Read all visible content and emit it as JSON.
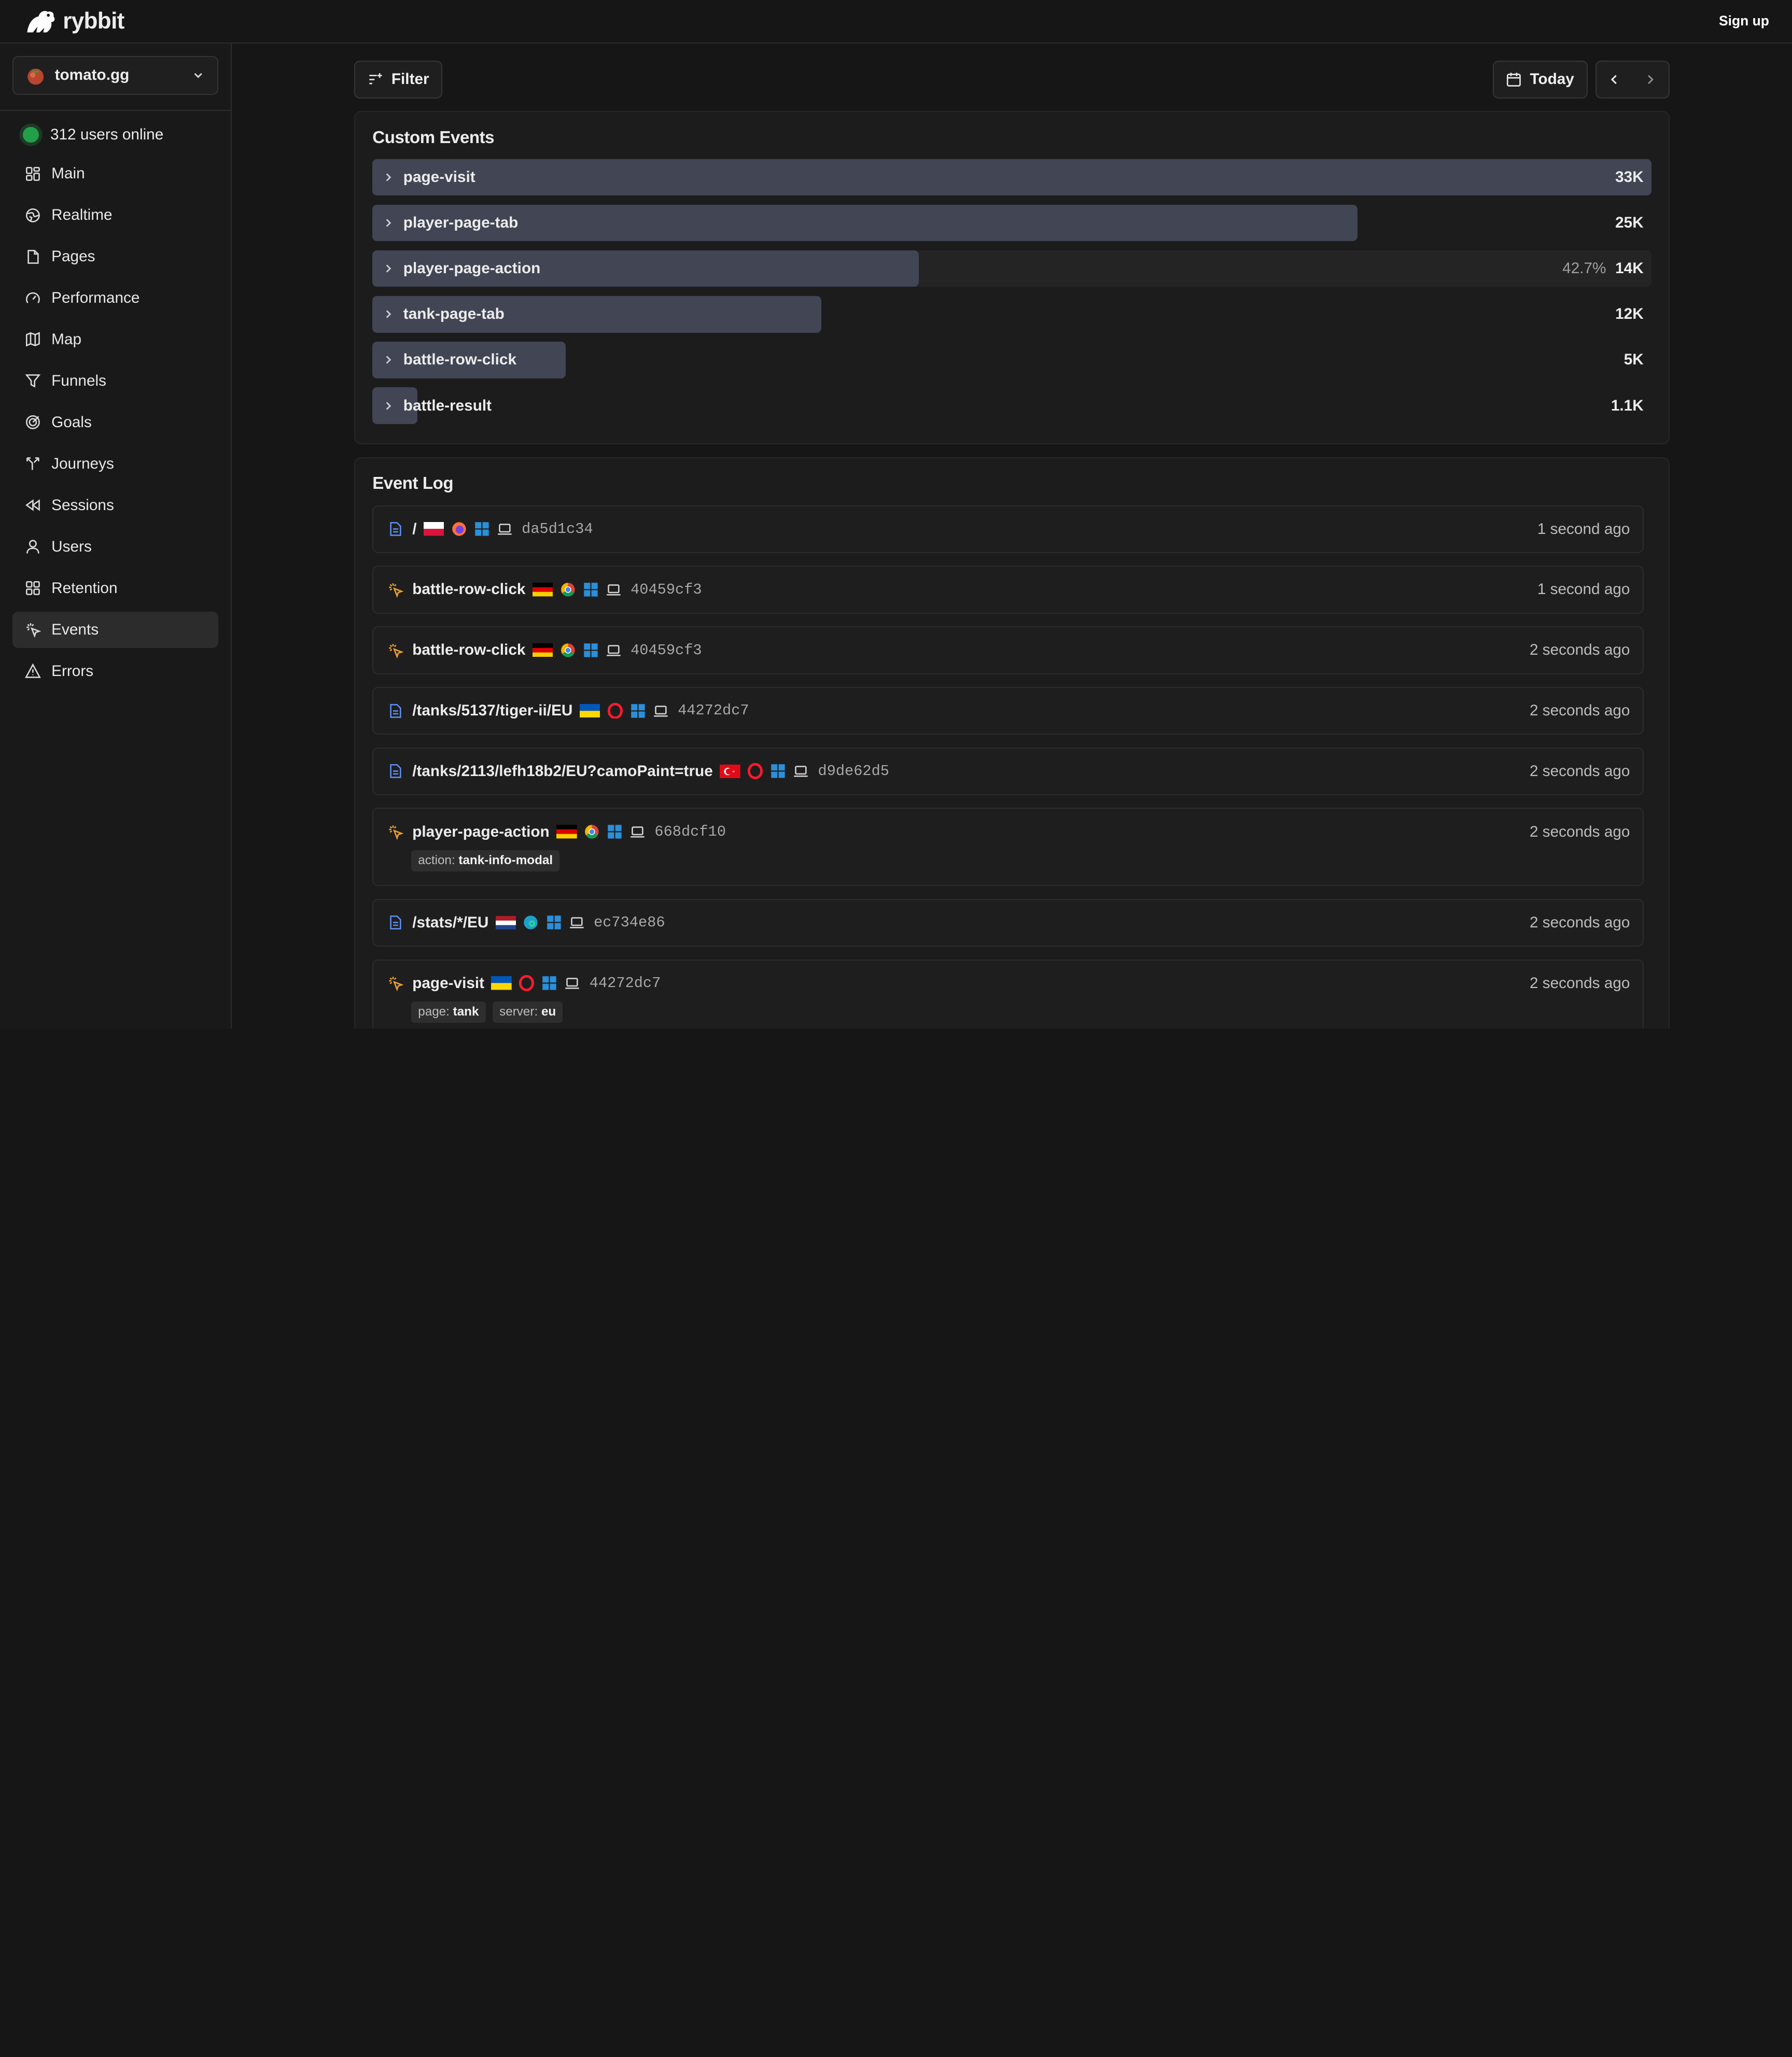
{
  "app": {
    "brand": "rybbit",
    "signup": "Sign up"
  },
  "sidebar": {
    "site": "tomato.gg",
    "online": "312 users online",
    "items": [
      {
        "label": "Main",
        "icon": "grid-icon"
      },
      {
        "label": "Realtime",
        "icon": "globe-icon"
      },
      {
        "label": "Pages",
        "icon": "file-icon"
      },
      {
        "label": "Performance",
        "icon": "gauge-icon"
      },
      {
        "label": "Map",
        "icon": "map-icon"
      },
      {
        "label": "Funnels",
        "icon": "funnel-icon"
      },
      {
        "label": "Goals",
        "icon": "target-icon"
      },
      {
        "label": "Journeys",
        "icon": "split-icon"
      },
      {
        "label": "Sessions",
        "icon": "rewind-icon"
      },
      {
        "label": "Users",
        "icon": "user-icon"
      },
      {
        "label": "Retention",
        "icon": "grid-icon"
      },
      {
        "label": "Events",
        "icon": "sparkle-icon",
        "active": true
      },
      {
        "label": "Errors",
        "icon": "warning-icon"
      }
    ]
  },
  "toolbar": {
    "filter": "Filter",
    "date": "Today"
  },
  "custom_events": {
    "title": "Custom Events",
    "rows": [
      {
        "name": "page-visit",
        "value": "33K",
        "fraction": 1.0
      },
      {
        "name": "player-page-tab",
        "value": "25K",
        "fraction": 0.77
      },
      {
        "name": "player-page-action",
        "value": "14K",
        "pct": "42.7%",
        "fraction": 0.427
      },
      {
        "name": "tank-page-tab",
        "value": "12K",
        "fraction": 0.351
      },
      {
        "name": "battle-row-click",
        "value": "5K",
        "fraction": 0.151
      },
      {
        "name": "battle-result",
        "value": "1.1K",
        "fraction": 0.035
      }
    ]
  },
  "event_log": {
    "title": "Event Log",
    "items": [
      {
        "type": "pageview",
        "name": "/",
        "flag": "pl",
        "browser": "firefox",
        "hash": "da5d1c34",
        "time": "1 second ago"
      },
      {
        "type": "event",
        "name": "battle-row-click",
        "flag": "de",
        "browser": "chrome",
        "hash": "40459cf3",
        "time": "1 second ago"
      },
      {
        "type": "event",
        "name": "battle-row-click",
        "flag": "de",
        "browser": "chrome",
        "hash": "40459cf3",
        "time": "2 seconds ago"
      },
      {
        "type": "pageview",
        "name": "/tanks/5137/tiger-ii/EU",
        "flag": "ua",
        "browser": "opera",
        "hash": "44272dc7",
        "time": "2 seconds ago"
      },
      {
        "type": "pageview",
        "name": "/tanks/2113/lefh18b2/EU?camoPaint=true",
        "flag": "tr",
        "browser": "opera",
        "hash": "d9de62d5",
        "time": "2 seconds ago"
      },
      {
        "type": "event",
        "name": "player-page-action",
        "flag": "de",
        "browser": "chrome",
        "hash": "668dcf10",
        "time": "2 seconds ago",
        "props": [
          {
            "k": "action:",
            "v": "tank-info-modal"
          }
        ]
      },
      {
        "type": "pageview",
        "name": "/stats/*/EU",
        "flag": "nl",
        "browser": "edge",
        "hash": "ec734e86",
        "time": "2 seconds ago"
      },
      {
        "type": "event",
        "name": "page-visit",
        "flag": "ua",
        "browser": "opera",
        "hash": "44272dc7",
        "time": "2 seconds ago",
        "props": [
          {
            "k": "page:",
            "v": "tank"
          },
          {
            "k": "server:",
            "v": "eu"
          }
        ]
      }
    ]
  },
  "colors": {
    "bar": "#414554",
    "online": "#22a049",
    "accent_page": "#5b8def",
    "accent_event": "#f0a030"
  }
}
